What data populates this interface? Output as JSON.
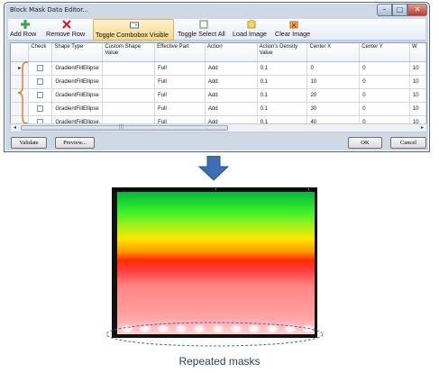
{
  "window": {
    "title": "Block Mask Data Editor..."
  },
  "title_buttons": {
    "minimize": "–",
    "maximize": "□",
    "close": "✕"
  },
  "toolbar": {
    "add_row": "Add Row",
    "remove_row": "Remove Row",
    "toggle_combobox": "Toggle Combobox Visible",
    "toggle_select_all": "Toggle Select All",
    "load_image": "Load Image",
    "clear_image": "Clear Image"
  },
  "grid": {
    "columns": [
      "Check",
      "Shape Type",
      "Custom Shape Value",
      "Effective Part",
      "Action",
      "Action's Density Value",
      "Center X",
      "Center Y",
      "W"
    ],
    "rows": [
      {
        "shape_type": "GradientFillEllipse",
        "custom_value": "",
        "effective_part": "Full",
        "action": "Add",
        "density": "0.1",
        "center_x": "0",
        "center_y": "0",
        "w": "10"
      },
      {
        "shape_type": "GradientFillEllipse",
        "custom_value": "",
        "effective_part": "Full",
        "action": "Add",
        "density": "0.1",
        "center_x": "10",
        "center_y": "0",
        "w": "10"
      },
      {
        "shape_type": "GradientFillEllipse",
        "custom_value": "",
        "effective_part": "Full",
        "action": "Add",
        "density": "0.1",
        "center_x": "20",
        "center_y": "0",
        "w": "10"
      },
      {
        "shape_type": "GradientFillEllipse",
        "custom_value": "",
        "effective_part": "Full",
        "action": "Add",
        "density": "0.1",
        "center_x": "30",
        "center_y": "0",
        "w": "10"
      },
      {
        "shape_type": "GradientFillEllipse",
        "custom_value": "",
        "effective_part": "Full",
        "action": "Add",
        "density": "0.1",
        "center_x": "40",
        "center_y": "0",
        "w": "10"
      }
    ],
    "current_row_marker": "▸"
  },
  "scrollbar": {
    "left_arrow": "◂",
    "right_arrow": "▸",
    "grip": "|||"
  },
  "buttons": {
    "validate": "Validate",
    "preview": "Preview...",
    "ok": "OK",
    "cancel": "Cancel"
  },
  "preview_image": {
    "mask_count": 11
  },
  "caption": "Repeated masks",
  "colors": {
    "accent_arrow": "#3c6fb4",
    "ellipse_stroke": "#3c6fb4",
    "caption": "#2b3f63"
  }
}
